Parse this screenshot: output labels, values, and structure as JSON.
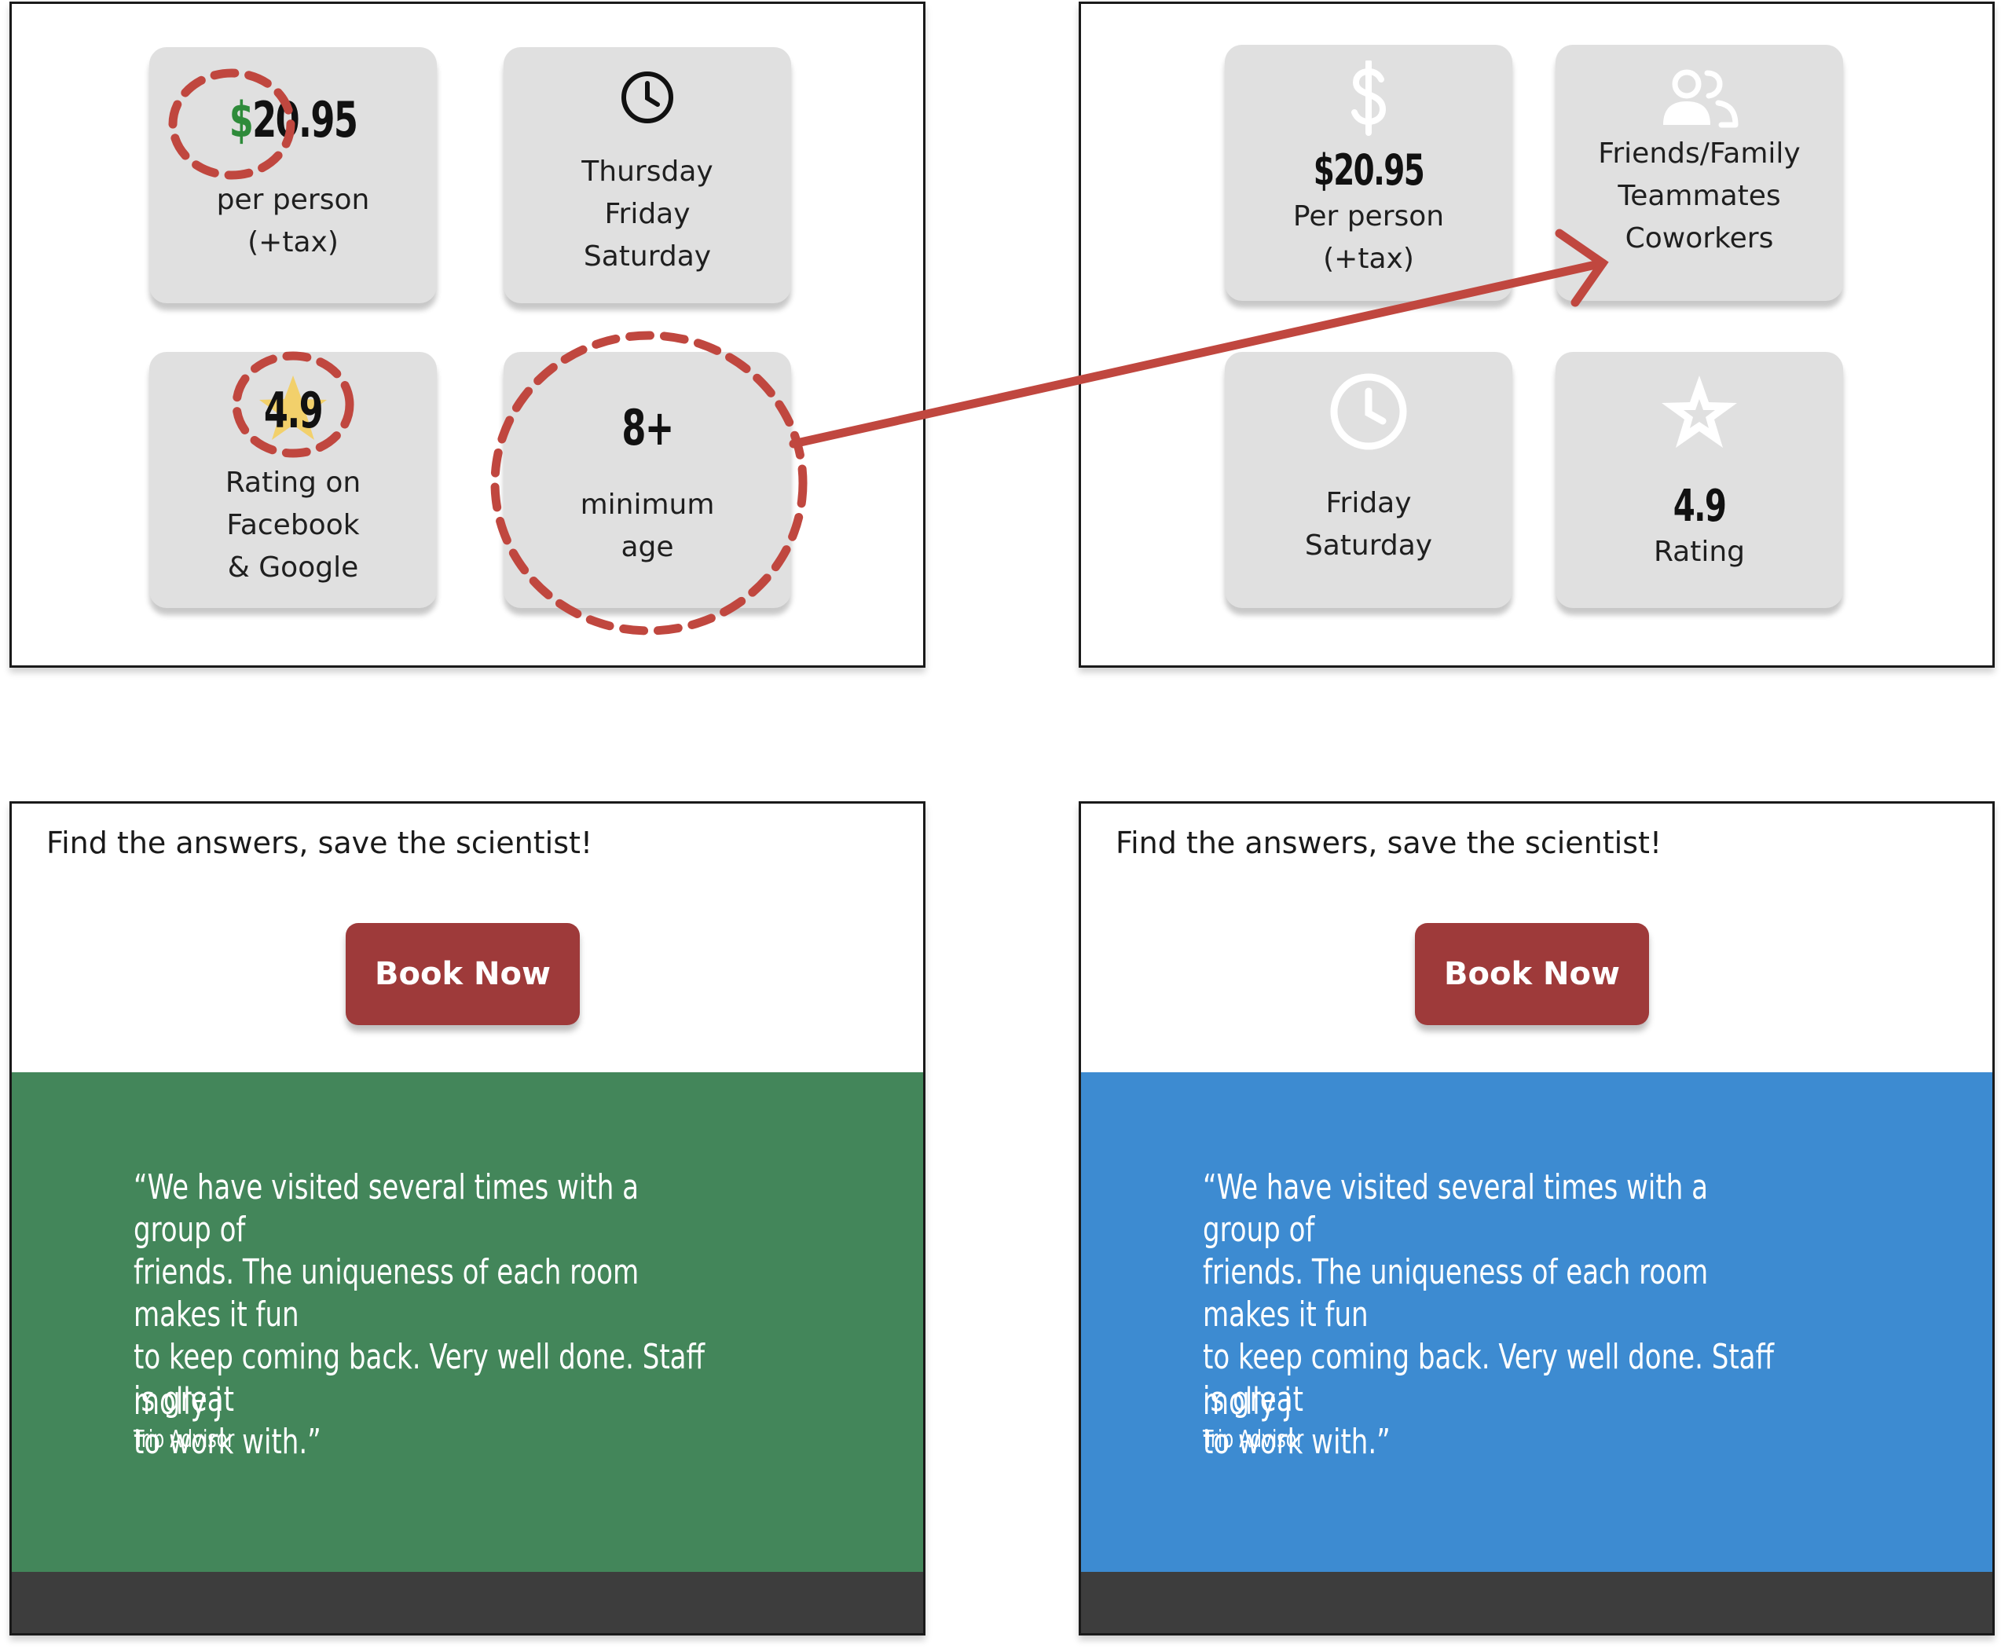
{
  "colors": {
    "annotation": "#c0473f",
    "card_bg": "#e0e0e0",
    "button_bg": "#9e3a3a",
    "green_bg": "#43865a",
    "blue_bg": "#3d8bd1",
    "footer_bg": "#3d3d3d",
    "dollar_green": "#2e8b3a",
    "star_yellow": "#f2d06b"
  },
  "original": {
    "price": {
      "value": "$20.95",
      "dollar": "$",
      "amount": "20.95",
      "line1": "per person",
      "line2": "(+tax)"
    },
    "days": {
      "icon": "clock-icon",
      "lines": [
        "Thursday",
        "Friday",
        "Saturday"
      ]
    },
    "rating": {
      "value": "4.9",
      "icon": "star-icon",
      "lines": [
        "Rating on",
        "Facebook",
        "& Google"
      ]
    },
    "age": {
      "value": "8+",
      "lines": [
        "minimum",
        "age"
      ]
    }
  },
  "redesign": {
    "price": {
      "icon": "dollar-icon",
      "value": "$20.95",
      "lines": [
        "Per person",
        "(+tax)"
      ]
    },
    "groups": {
      "icon": "people-icon",
      "lines": [
        "Friends/Family",
        "Teammates",
        "Coworkers"
      ]
    },
    "days": {
      "icon": "clock-icon",
      "lines": [
        "Friday",
        "Saturday"
      ]
    },
    "rating": {
      "icon": "star-icon",
      "value": "4.9",
      "line": "Rating"
    }
  },
  "cta": {
    "tagline": "Find the answers, save the scientist!",
    "button_label": "Book Now"
  },
  "testimonial": {
    "quote_lines": [
      "“We have visited several times with a group of",
      "friends. The uniqueness of each room makes it fun",
      "to keep coming back. Very well done. Staff is great",
      "to work with.”"
    ],
    "author": "molly j",
    "source": "Trip Advisor"
  }
}
